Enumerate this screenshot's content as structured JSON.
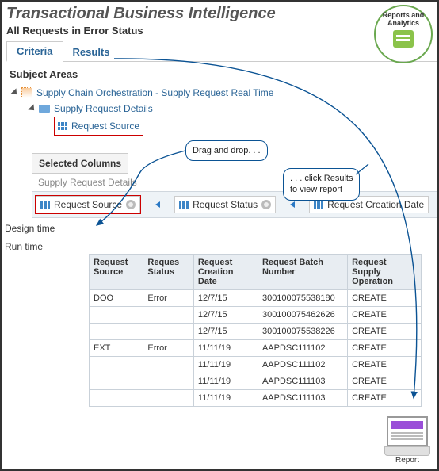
{
  "header": {
    "title": "Transactional Business Intelligence",
    "subtitle": "All Requests in Error Status"
  },
  "tabs": {
    "criteria": "Criteria",
    "results": "Results"
  },
  "subject_areas": {
    "heading": "Subject Areas",
    "root": "Supply Chain Orchestration - Supply Request Real Time",
    "folder": "Supply Request Details",
    "column": "Request Source"
  },
  "selected_columns": {
    "heading": "Selected Columns",
    "group": "Supply Request Details",
    "cols": [
      "Request Source",
      "Request Status",
      "Request Creation Date"
    ]
  },
  "callouts": {
    "drag": "Drag and drop. . .",
    "results_a": ". . . click Results",
    "results_b": "to view report"
  },
  "badge": {
    "line1": "Reports and",
    "line2": "Analytics"
  },
  "phase": {
    "design": "Design time",
    "run": "Run time"
  },
  "report": {
    "headers": [
      "Request Source",
      "Reques Status",
      "Request Creation Date",
      "Request Batch Number",
      "Request Supply Operation"
    ],
    "rows": [
      {
        "src": "DOO",
        "status": "Error",
        "date": "12/7/15",
        "batch": "300100075538180",
        "op": "CREATE"
      },
      {
        "src": "",
        "status": "",
        "date": "12/7/15",
        "batch": "300100075462626",
        "op": "CREATE"
      },
      {
        "src": "",
        "status": "",
        "date": "12/7/15",
        "batch": "300100075538226",
        "op": "CREATE"
      },
      {
        "src": "EXT",
        "status": "Error",
        "date": "11/11/19",
        "batch": "AAPDSC111102",
        "op": "CREATE"
      },
      {
        "src": "",
        "status": "",
        "date": "11/11/19",
        "batch": "AAPDSC111102",
        "op": "CREATE"
      },
      {
        "src": "",
        "status": "",
        "date": "11/11/19",
        "batch": "AAPDSC111103",
        "op": "CREATE"
      },
      {
        "src": "",
        "status": "",
        "date": "11/11/19",
        "batch": "AAPDSC111103",
        "op": "CREATE"
      }
    ]
  },
  "report_icon": {
    "label": "Report"
  }
}
